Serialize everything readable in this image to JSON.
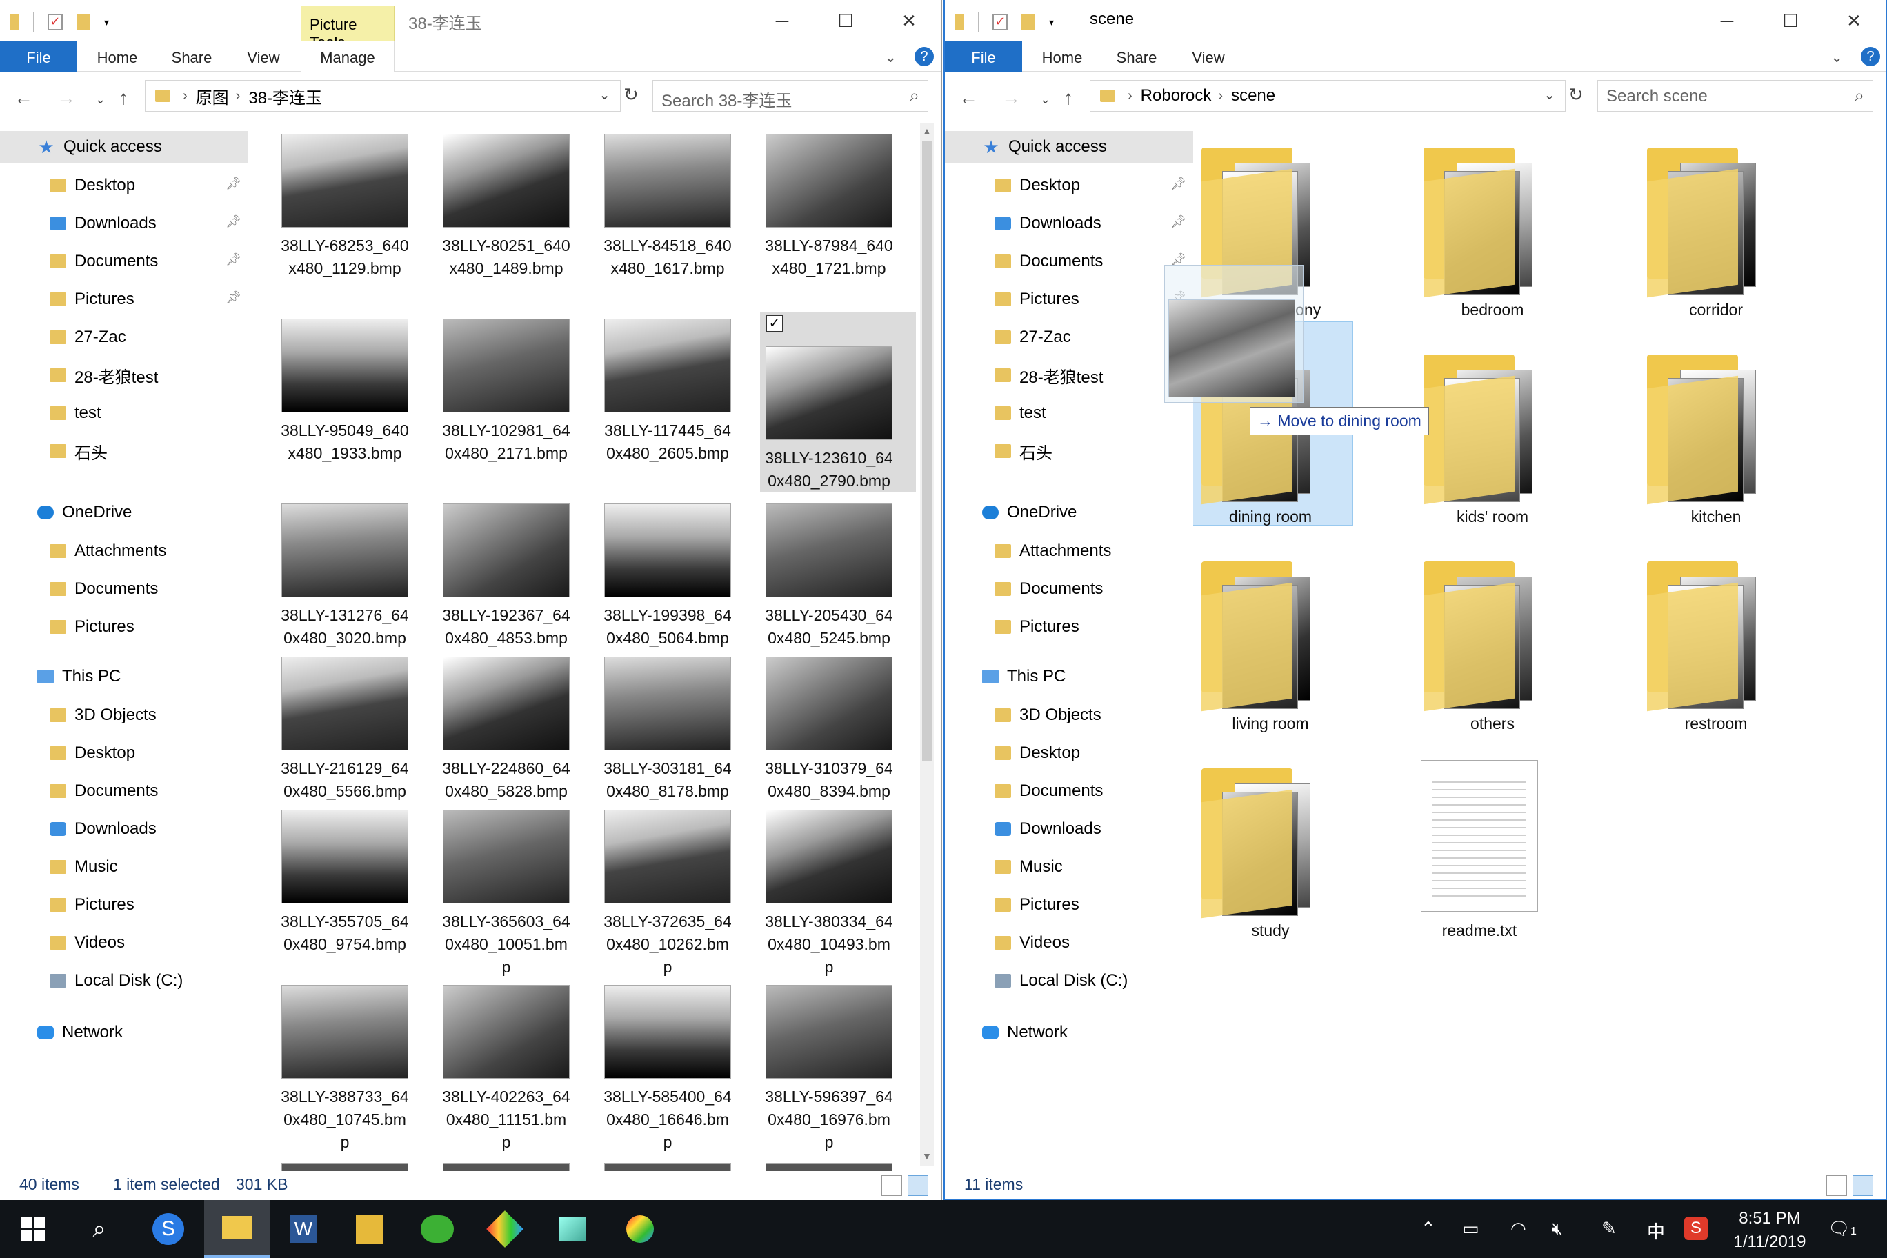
{
  "left": {
    "title": "38-李连玉",
    "tool_tab": "Picture Tools",
    "ribbon": {
      "file": "File",
      "home": "Home",
      "share": "Share",
      "view": "View",
      "manage": "Manage"
    },
    "address": [
      "原图",
      "38-李连玉"
    ],
    "search_placeholder": "Search 38-李连玉",
    "status": {
      "count": "40 items",
      "selected": "1 item selected",
      "size": "301 KB"
    },
    "thumbs": [
      [
        "38LLY-68253_640",
        "x480_1129.bmp"
      ],
      [
        "38LLY-80251_640",
        "x480_1489.bmp"
      ],
      [
        "38LLY-84518_640",
        "x480_1617.bmp"
      ],
      [
        "38LLY-87984_640",
        "x480_1721.bmp"
      ],
      [
        "38LLY-95049_640",
        "x480_1933.bmp"
      ],
      [
        "38LLY-102981_64",
        "0x480_2171.bmp"
      ],
      [
        "38LLY-117445_64",
        "0x480_2605.bmp"
      ],
      [
        "38LLY-123610_64",
        "0x480_2790.bmp"
      ],
      [
        "38LLY-131276_64",
        "0x480_3020.bmp"
      ],
      [
        "38LLY-192367_64",
        "0x480_4853.bmp"
      ],
      [
        "38LLY-199398_64",
        "0x480_5064.bmp"
      ],
      [
        "38LLY-205430_64",
        "0x480_5245.bmp"
      ],
      [
        "38LLY-216129_64",
        "0x480_5566.bmp"
      ],
      [
        "38LLY-224860_64",
        "0x480_5828.bmp"
      ],
      [
        "38LLY-303181_64",
        "0x480_8178.bmp"
      ],
      [
        "38LLY-310379_64",
        "0x480_8394.bmp"
      ],
      [
        "38LLY-355705_64",
        "0x480_9754.bmp"
      ],
      [
        "38LLY-365603_64",
        "0x480_10051.bm",
        "p"
      ],
      [
        "38LLY-372635_64",
        "0x480_10262.bm",
        "p"
      ],
      [
        "38LLY-380334_64",
        "0x480_10493.bm",
        "p"
      ],
      [
        "38LLY-388733_64",
        "0x480_10745.bm",
        "p"
      ],
      [
        "38LLY-402263_64",
        "0x480_11151.bm",
        "p"
      ],
      [
        "38LLY-585400_64",
        "0x480_16646.bm",
        "p"
      ],
      [
        "38LLY-596397_64",
        "0x480_16976.bm",
        "p"
      ]
    ]
  },
  "right": {
    "title": "scene",
    "ribbon": {
      "file": "File",
      "home": "Home",
      "share": "Share",
      "view": "View"
    },
    "address": [
      "Roborock",
      "scene"
    ],
    "search_placeholder": "Search scene",
    "status": {
      "count": "11 items"
    },
    "folders": [
      "balcony",
      "bedroom",
      "corridor",
      "dining room",
      "kids' room",
      "kitchen",
      "living room",
      "others",
      "restroom",
      "study"
    ],
    "balcony_visible": "alcony",
    "file": "readme.txt",
    "tooltip": "Move to dining room"
  },
  "nav": {
    "quick_access": "Quick access",
    "qa_items": [
      "Desktop",
      "Downloads",
      "Documents",
      "Pictures",
      "27-Zac",
      "28-老狼test",
      "test",
      "石头"
    ],
    "onedrive": "OneDrive",
    "od_items": [
      "Attachments",
      "Documents",
      "Pictures"
    ],
    "this_pc": "This PC",
    "pc_items": [
      "3D Objects",
      "Desktop",
      "Documents",
      "Downloads",
      "Music",
      "Pictures",
      "Videos",
      "Local Disk (C:)"
    ],
    "network": "Network"
  },
  "taskbar": {
    "time": "8:51 PM",
    "date": "1/11/2019",
    "ime": "中",
    "notif_count": "1"
  }
}
